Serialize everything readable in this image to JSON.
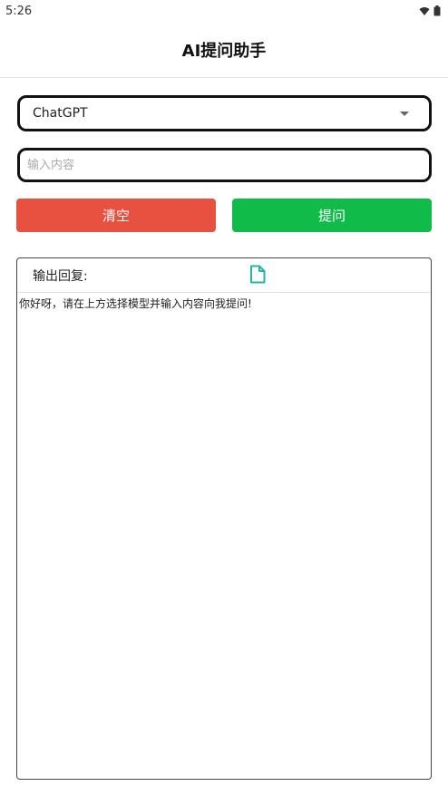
{
  "status_bar": {
    "time": "5:26"
  },
  "app_bar": {
    "title": "AI提问助手"
  },
  "model_select": {
    "selected": "ChatGPT"
  },
  "question_input": {
    "value": "",
    "placeholder": "输入内容"
  },
  "buttons": {
    "clear_label": "清空",
    "ask_label": "提问"
  },
  "output": {
    "header_label": "输出回复:",
    "text": "你好呀，请在上方选择模型并输入内容向我提问!"
  },
  "colors": {
    "clear": "#e8503f",
    "ask": "#10bb4a",
    "doc_icon": "#27b3a6"
  },
  "icons": [
    "wifi-icon",
    "battery-icon",
    "chevron-down-icon",
    "document-icon"
  ]
}
